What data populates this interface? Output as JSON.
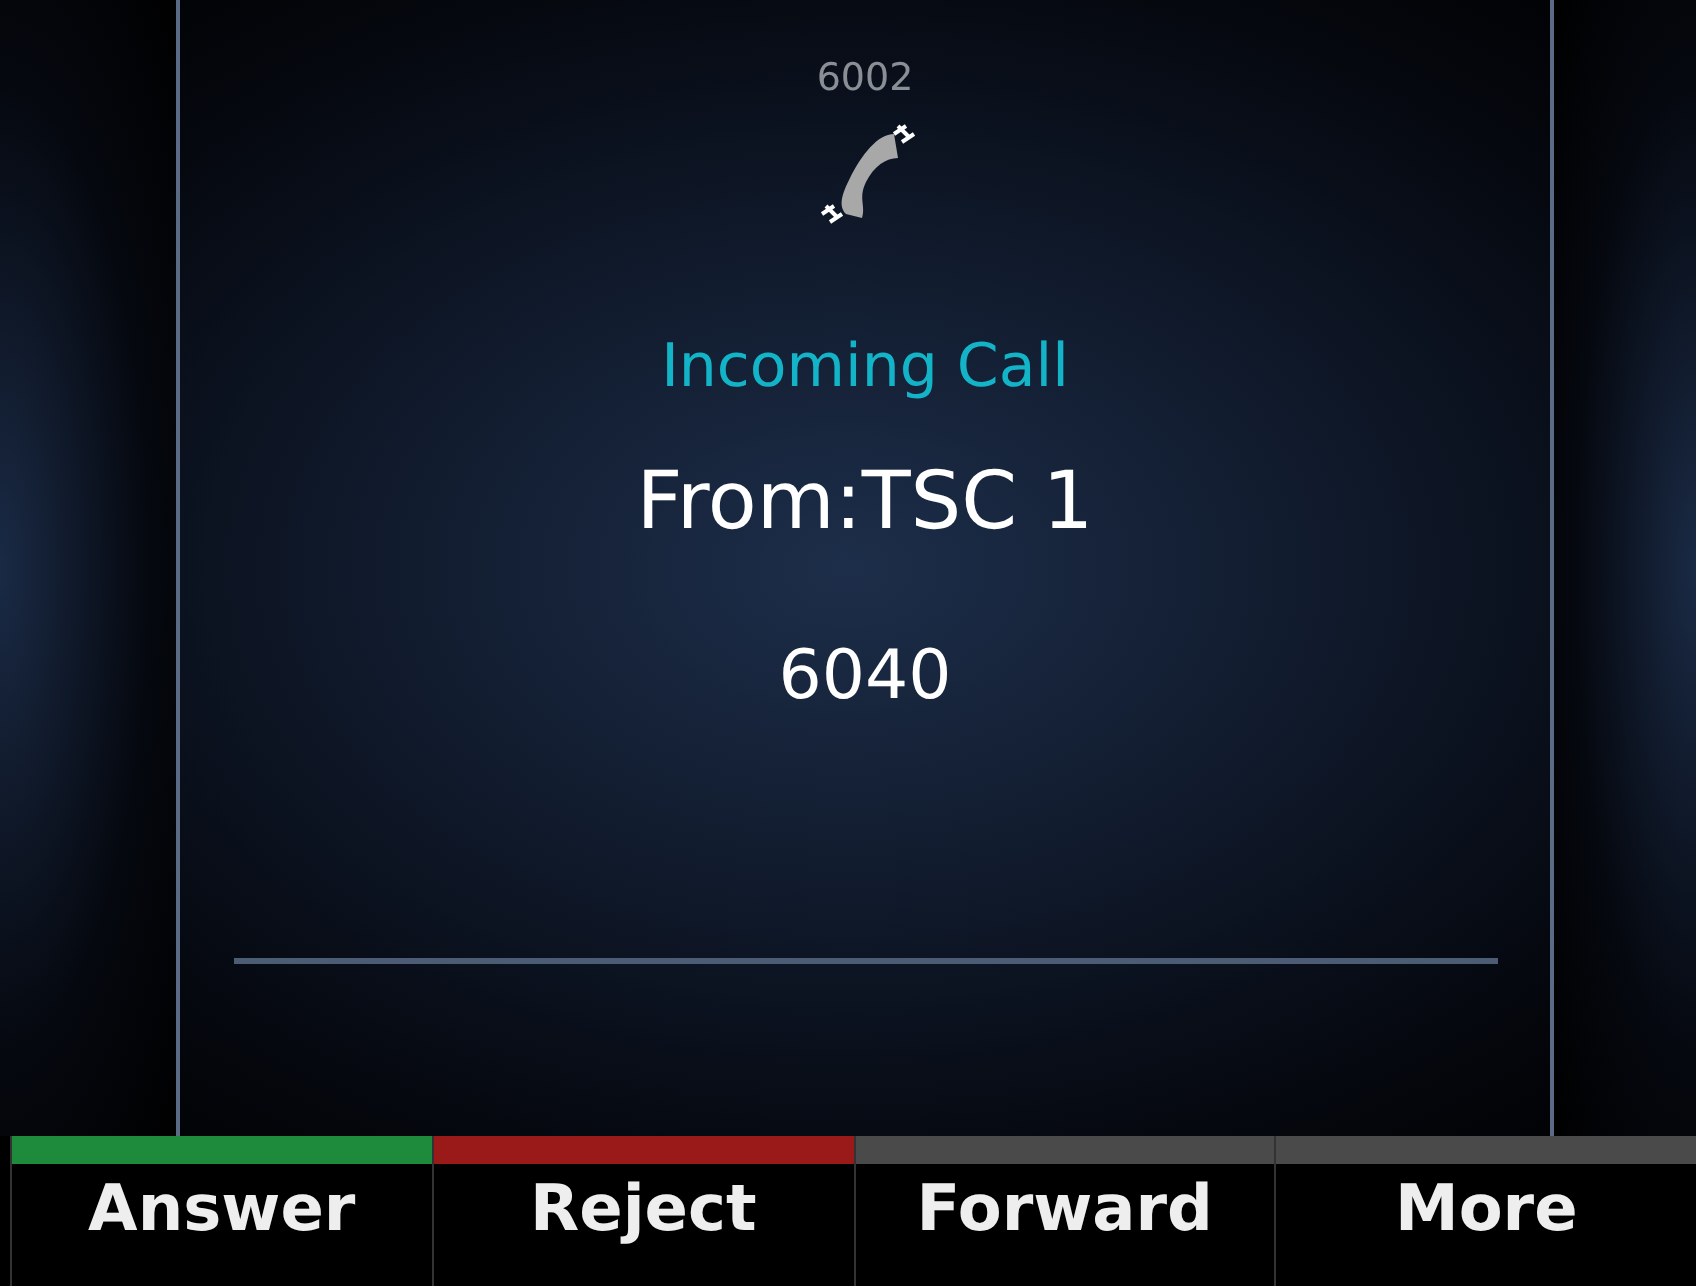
{
  "line": "6002",
  "call": {
    "status": "Incoming Call",
    "from": "From:TSC 1",
    "number": "6040"
  },
  "softkeys": [
    {
      "label": "Answer",
      "color": "#1e8a3c"
    },
    {
      "label": "Reject",
      "color": "#9a1a1a"
    },
    {
      "label": "Forward",
      "color": "#4a4a4a"
    },
    {
      "label": "More",
      "color": "#4a4a4a"
    }
  ]
}
